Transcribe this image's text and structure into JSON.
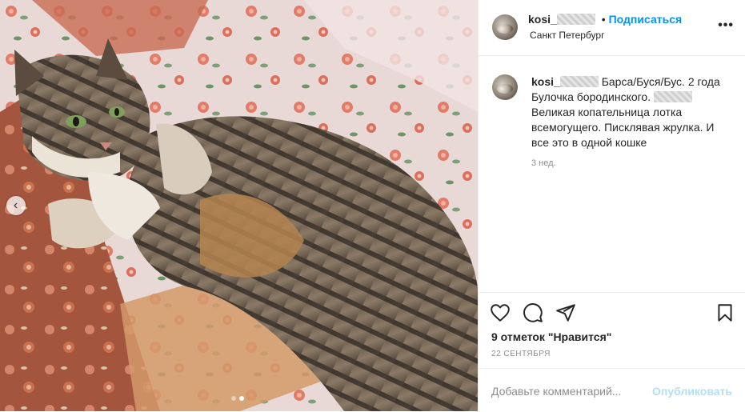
{
  "post": {
    "username": "kosi_",
    "follow_label": "Подписаться",
    "separator": "•",
    "location": "Санкт Петербург",
    "more_label": "•••"
  },
  "caption": {
    "username": "kosi_",
    "text_part1": "Барса/Буся/Бус. 2 года Булочка бородинского.",
    "text_part2": "Великая копательница лотка всемогущего. Писклявая жрулка. И все это в одной кошке",
    "time": "3 нед."
  },
  "actions": {
    "icons": [
      "heart-icon",
      "comment-icon",
      "share-icon",
      "bookmark-icon"
    ]
  },
  "likes": "9 отметок \"Нравится\"",
  "date": "22 сентября",
  "comment": {
    "placeholder": "Добавьте комментарий...",
    "publish_label": "Опубликовать"
  },
  "carousel": {
    "prev_icon": "chevron-left-icon",
    "slides": 2,
    "active_slide": 2
  },
  "colors": {
    "accent": "#0095f6",
    "publish_disabled": "#b2dffc",
    "muted": "#8e8e8e"
  }
}
